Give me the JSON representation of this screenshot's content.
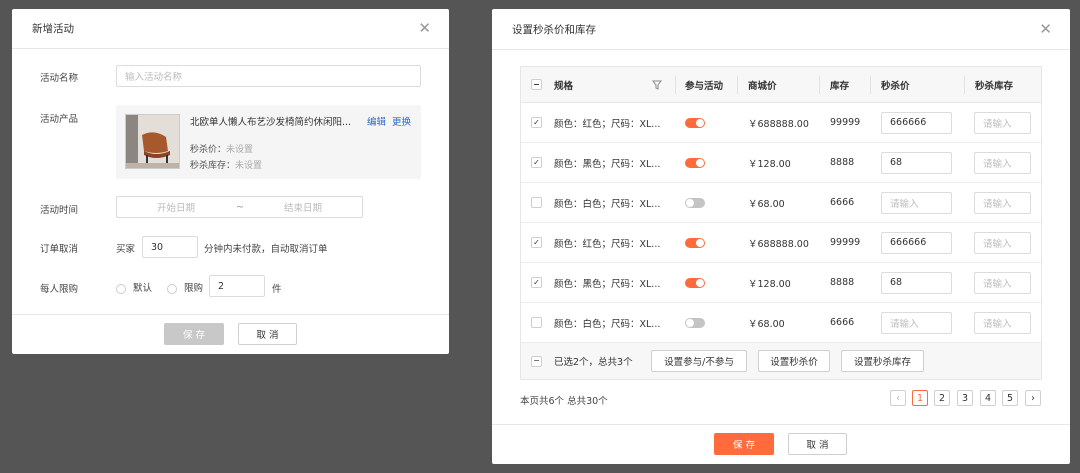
{
  "add_modal": {
    "title": "新增活动",
    "close": "✕",
    "name_label": "活动名称",
    "name_placeholder": "输入活动名称",
    "product_label": "活动产品",
    "product": {
      "name": "北欧单人懒人布艺沙发椅简约休闲阳...",
      "edit": "编辑",
      "replace": "更换",
      "price_label": "秒杀价：",
      "price_value": "未设置",
      "stock_label": "秒杀库存：",
      "stock_value": "未设置"
    },
    "time_label": "活动时间",
    "start_placeholder": "开始日期",
    "range_sep": "~",
    "end_placeholder": "结束日期",
    "cancel_label": "订单取消",
    "buyer_text": "买家",
    "minutes_value": "30",
    "cancel_suffix": "分钟内未付款，自动取消订单",
    "limit_label": "每人限购",
    "default_option": "默认",
    "limit_option": "限购",
    "limit_value": "2",
    "unit": "件",
    "save": "保 存",
    "cancel": "取 消"
  },
  "price_modal": {
    "title": "设置秒杀价和库存",
    "close": "✕",
    "headers": {
      "spec": "规格",
      "join": "参与活动",
      "mall_price": "商城价",
      "stock": "库存",
      "sec_price": "秒杀价",
      "sec_stock": "秒杀库存"
    },
    "rows": [
      {
        "checked": true,
        "spec": "颜色：红色；尺码：XL...",
        "on": true,
        "price": "￥688888.00",
        "stock": "99999",
        "sec_price": "666666",
        "sec_stock": "请输入"
      },
      {
        "checked": true,
        "spec": "颜色：黑色；尺码：XL...",
        "on": true,
        "price": "￥128.00",
        "stock": "8888",
        "sec_price": "68",
        "sec_stock": "请输入"
      },
      {
        "checked": false,
        "spec": "颜色：白色；尺码：XL...",
        "on": false,
        "price": "￥68.00",
        "stock": "6666",
        "sec_price": "请输入",
        "sec_stock": "请输入"
      },
      {
        "checked": true,
        "spec": "颜色：红色；尺码：XL...",
        "on": true,
        "price": "￥688888.00",
        "stock": "99999",
        "sec_price": "666666",
        "sec_stock": "请输入"
      },
      {
        "checked": true,
        "spec": "颜色：黑色；尺码：XL...",
        "on": true,
        "price": "￥128.00",
        "stock": "8888",
        "sec_price": "68",
        "sec_stock": "请输入"
      },
      {
        "checked": false,
        "spec": "颜色：白色；尺码：XL...",
        "on": false,
        "price": "￥68.00",
        "stock": "6666",
        "sec_price": "请输入",
        "sec_stock": "请输入"
      }
    ],
    "footer_text": "已选2个，总共3个",
    "btn_join": "设置参与/不参与",
    "btn_price": "设置秒杀价",
    "btn_stock": "设置秒杀库存",
    "summary": "本页共6个  总共30个",
    "pages": [
      "1",
      "2",
      "3",
      "4",
      "5"
    ],
    "current_page": "1",
    "prev": "‹",
    "next": "›",
    "save": "保 存",
    "cancel": "取 消"
  },
  "colors": {
    "accent": "#ff6b3d",
    "link": "#2d6ac9",
    "overlay": "#555555"
  },
  "icons": [
    "close-icon",
    "filter-icon",
    "checkbox-icon",
    "toggle-switch",
    "radio-icon",
    "chevron-left-icon",
    "chevron-right-icon"
  ]
}
